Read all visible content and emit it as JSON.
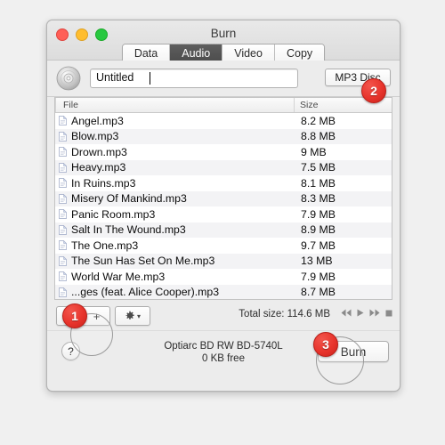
{
  "window": {
    "title": "Burn",
    "traffic_lights": [
      "close",
      "minimize",
      "zoom"
    ]
  },
  "tabs": [
    {
      "label": "Data",
      "active": false
    },
    {
      "label": "Audio",
      "active": true
    },
    {
      "label": "Video",
      "active": false
    },
    {
      "label": "Copy",
      "active": false
    }
  ],
  "toolbar": {
    "disc_icon": "cd-disc-icon",
    "name_value": "Untitled",
    "name_placeholder": "Untitled",
    "disc_type": "MP3 Disc"
  },
  "list": {
    "columns": [
      "File",
      "Size"
    ],
    "rows": [
      {
        "file": "Angel.mp3",
        "size": "8.2 MB"
      },
      {
        "file": "Blow.mp3",
        "size": "8.8 MB"
      },
      {
        "file": "Drown.mp3",
        "size": "9 MB"
      },
      {
        "file": "Heavy.mp3",
        "size": "7.5 MB"
      },
      {
        "file": "In Ruins.mp3",
        "size": "8.1 MB"
      },
      {
        "file": "Misery Of Mankind.mp3",
        "size": "8.3 MB"
      },
      {
        "file": "Panic Room.mp3",
        "size": "7.9 MB"
      },
      {
        "file": "Salt In The Wound.mp3",
        "size": "8.9 MB"
      },
      {
        "file": "The One.mp3",
        "size": "9.7 MB"
      },
      {
        "file": "The Sun Has Set On Me.mp3",
        "size": "13 MB"
      },
      {
        "file": "World War Me.mp3",
        "size": "7.9 MB"
      },
      {
        "file": "...ges (feat. Alice Cooper).mp3",
        "size": "8.7 MB"
      }
    ]
  },
  "bottom": {
    "remove_label": "−",
    "add_label": "+",
    "gear_icon": "gear-icon",
    "gear_chevron": "▾",
    "total_size": "Total size: 114.6 MB",
    "transport": [
      {
        "name": "rewind-icon",
        "glyph": "◀◀"
      },
      {
        "name": "play-icon",
        "glyph": "▶"
      },
      {
        "name": "fast-forward-icon",
        "glyph": "▶▶"
      },
      {
        "name": "stop-icon",
        "glyph": "■"
      }
    ]
  },
  "footer": {
    "help_label": "?",
    "drive_name": "Optiarc BD RW BD-5740L",
    "drive_free": "0 KB free",
    "burn_label": "Burn"
  },
  "annotations": [
    {
      "number": "1",
      "target": "add-button"
    },
    {
      "number": "2",
      "target": "disc-type-button"
    },
    {
      "number": "3",
      "target": "burn-button"
    }
  ],
  "colors": {
    "badge_red": "#e8342c",
    "tab_active": "#4f4f4f",
    "window_bg": "#ececec",
    "row_alt": "#f3f3f5"
  }
}
